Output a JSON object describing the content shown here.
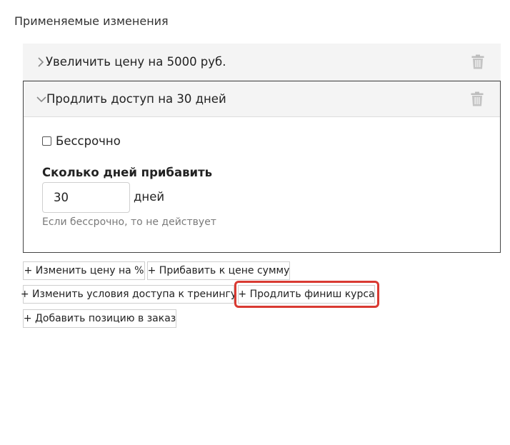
{
  "section": {
    "title": "Применяемые изменения"
  },
  "rules": [
    {
      "title": "Увеличить цену на 5000 руб.",
      "state": "collapsed",
      "chevron": "chevron-right-icon",
      "delete_icon": "trash-icon"
    },
    {
      "title": "Продлить доступ на 30 дней",
      "state": "expanded",
      "chevron": "chevron-down-icon",
      "delete_icon": "trash-icon",
      "unlimited_label": "Бессрочно",
      "unlimited_checked": false,
      "days_label": "Сколько дней прибавить",
      "days_value": "30",
      "days_unit": "дней",
      "hint": "Если бессрочно, то не действует"
    }
  ],
  "actions": [
    "+ Изменить цену на %",
    "+ Прибавить к цене сумму",
    "+ Изменить условия доступа к тренингу",
    "+ Продлить финиш курса",
    "+ Добавить позицию в заказ"
  ],
  "highlight": {
    "target": "+ Продлить финиш курса",
    "color": "#d93a32"
  },
  "colors": {
    "header_bg": "#f4f4f4",
    "border": "#444444",
    "hint": "#7a7a7a",
    "icon": "#b8b8b8"
  }
}
